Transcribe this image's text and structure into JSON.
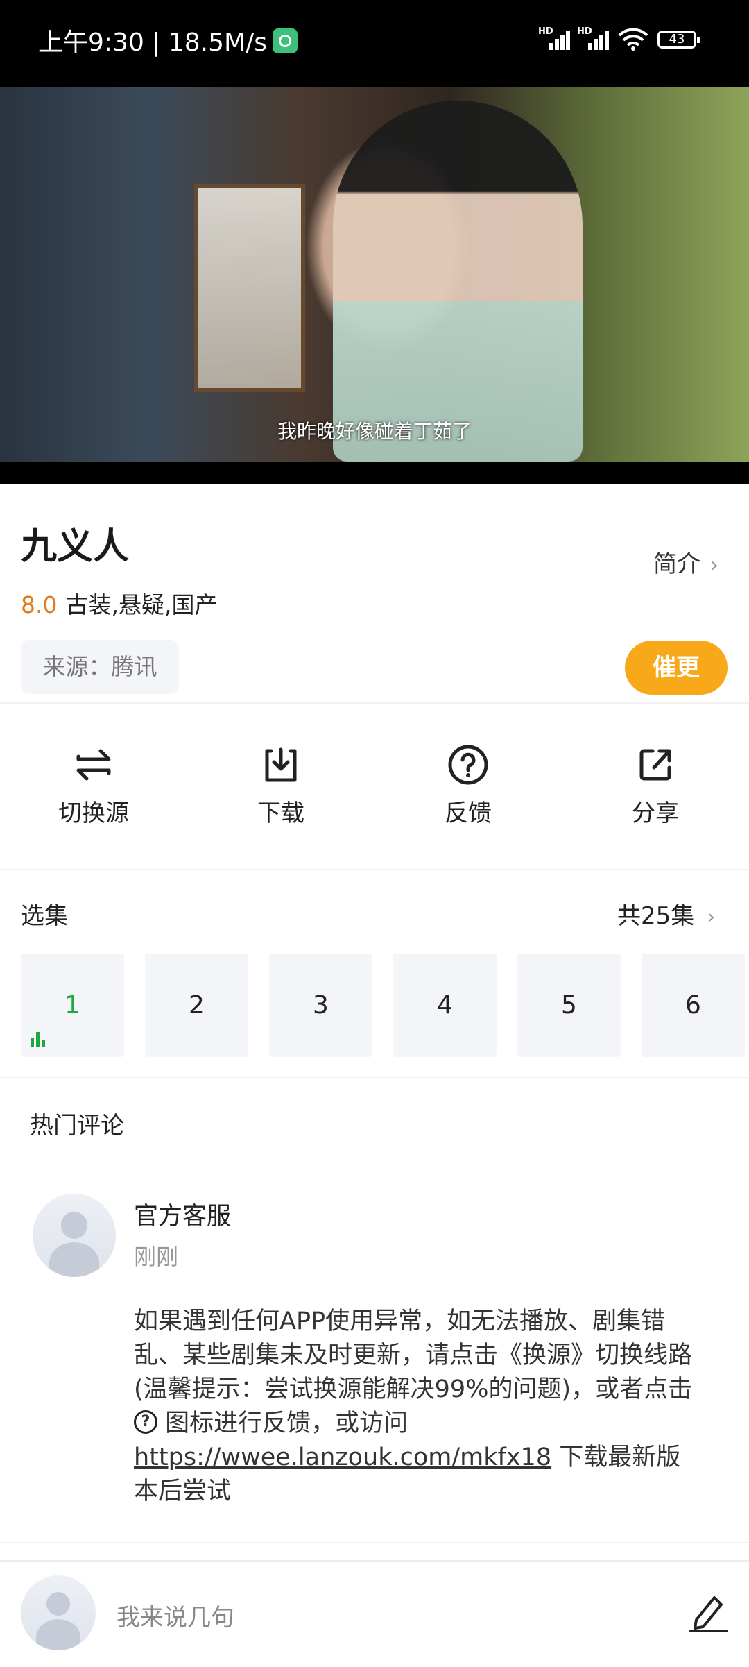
{
  "status_bar": {
    "time": "上午9:30",
    "net_speed": "18.5M/s",
    "signal_label_1": "HD",
    "signal_label_2": "HD",
    "battery": "43"
  },
  "video": {
    "subtitle": "我昨晚好像碰着丁茹了"
  },
  "show": {
    "title": "九义人",
    "intro_label": "简介",
    "score": "8.0",
    "genres": "古装,悬疑,国产",
    "source_label": "来源：腾讯",
    "urge_button": "催更"
  },
  "actions": [
    {
      "label": "切换源",
      "icon": "switch-source-icon"
    },
    {
      "label": "下载",
      "icon": "download-icon"
    },
    {
      "label": "反馈",
      "icon": "question-circle-icon"
    },
    {
      "label": "分享",
      "icon": "share-icon"
    }
  ],
  "episodes": {
    "title": "选集",
    "count_label": "共25集",
    "items": [
      "1",
      "2",
      "3",
      "4",
      "5",
      "6"
    ],
    "playing": "1"
  },
  "comments": {
    "title": "热门评论",
    "items": [
      {
        "author": "官方客服",
        "time": "刚刚",
        "text_part1": "如果遇到任何APP使用异常，如无法播放、剧集错乱、某些剧集未及时更新，请点击《换源》切换线路(温馨提示：尝试换源能解决99%的问题)，或者点击",
        "icon_glyph": "?",
        "text_part2": "图标进行反馈，或访问",
        "link": "https://wwee.lanzouk.com/mkfx18",
        "text_part3": "下载最新版本后尝试"
      }
    ]
  },
  "comment_input": {
    "placeholder": "我来说几句"
  },
  "colors": {
    "accent_orange": "#f8a91a",
    "score_orange": "#e07b1f",
    "playing_green": "#1fa83a",
    "chip_bg": "#f3f5f8"
  }
}
